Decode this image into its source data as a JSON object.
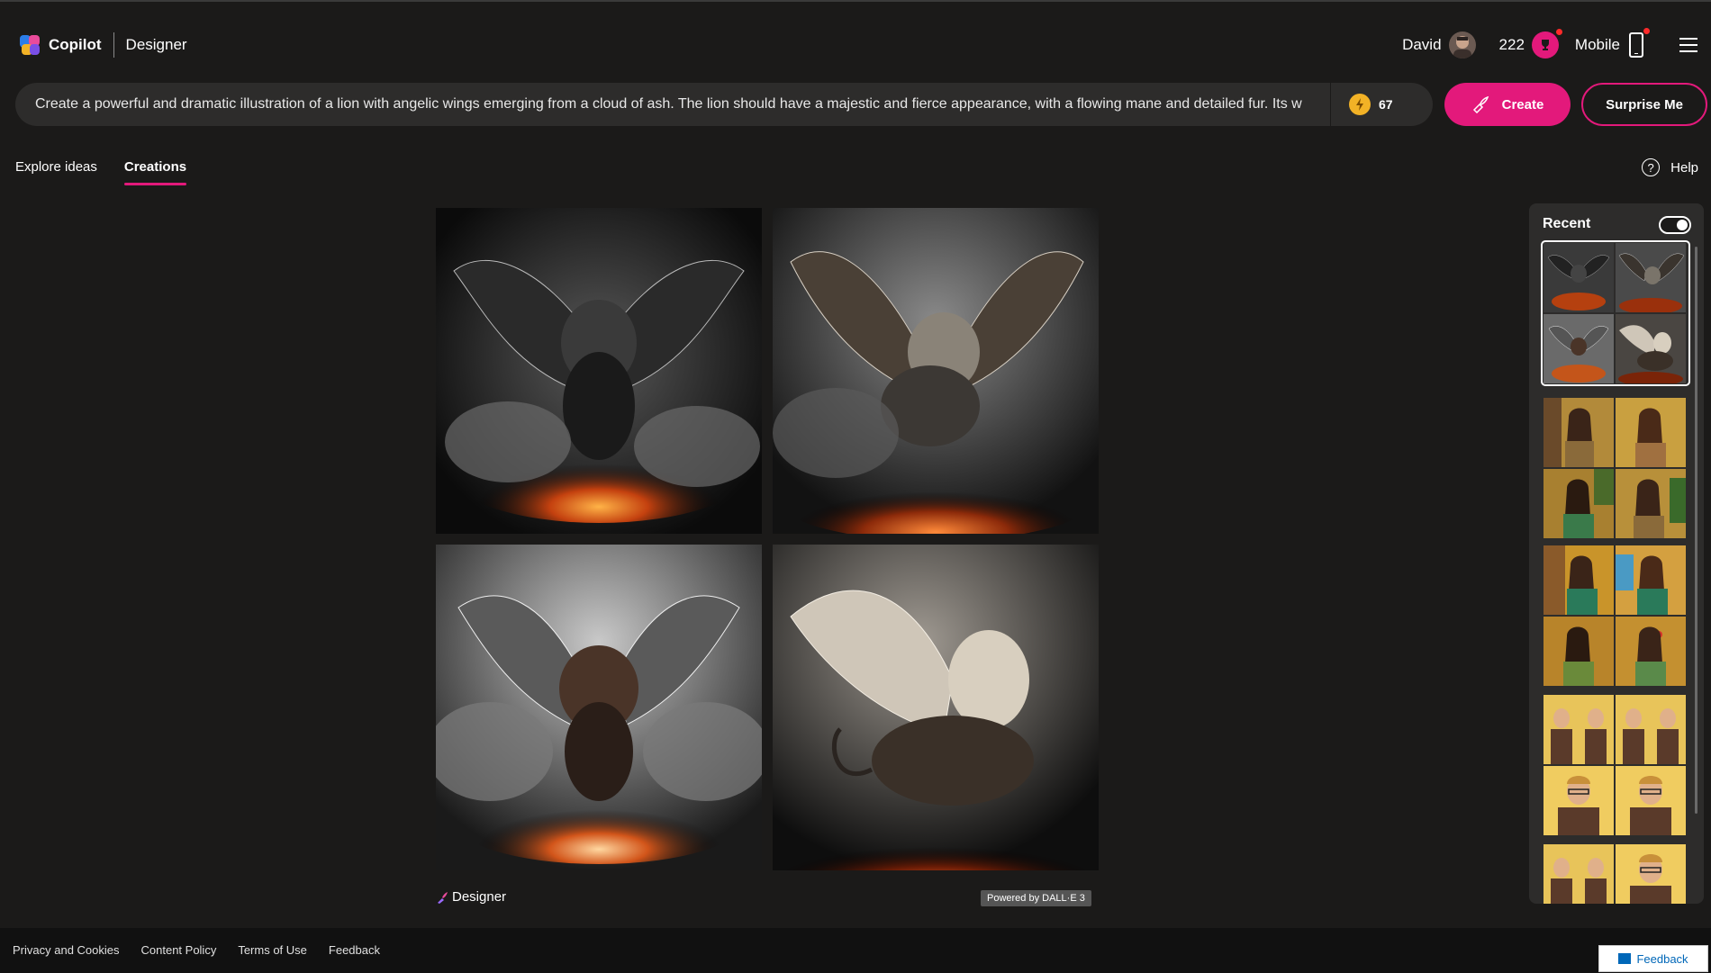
{
  "header": {
    "brand": "Copilot",
    "product": "Designer",
    "user_name": "David",
    "points": "222",
    "mobile_label": "Mobile"
  },
  "prompt": {
    "text": "Create a powerful and dramatic illustration of a lion with angelic wings emerging from a cloud of ash. The lion should have a majestic and fierce appearance, with a flowing mane and detailed fur. Its w",
    "boosts": "67",
    "create_label": "Create",
    "surprise_label": "Surprise Me"
  },
  "tabs": [
    {
      "label": "Explore ideas",
      "active": false
    },
    {
      "label": "Creations",
      "active": true
    }
  ],
  "help_label": "Help",
  "images": [
    {
      "icon": "winged-lion-image"
    },
    {
      "icon": "winged-lion-image"
    },
    {
      "icon": "winged-lion-image"
    },
    {
      "icon": "winged-lion-image"
    }
  ],
  "result_footer": {
    "designer_label": "Designer",
    "powered_label": "Powered by DALL·E 3"
  },
  "recent": {
    "title": "Recent",
    "toggle_on": true
  },
  "footer": {
    "links": [
      "Privacy and Cookies",
      "Content Policy",
      "Terms of Use",
      "Feedback"
    ],
    "feedback_button": "Feedback"
  },
  "colors": {
    "accent": "#e3197b",
    "background": "#1b1a19",
    "surface": "#2d2c2b"
  }
}
